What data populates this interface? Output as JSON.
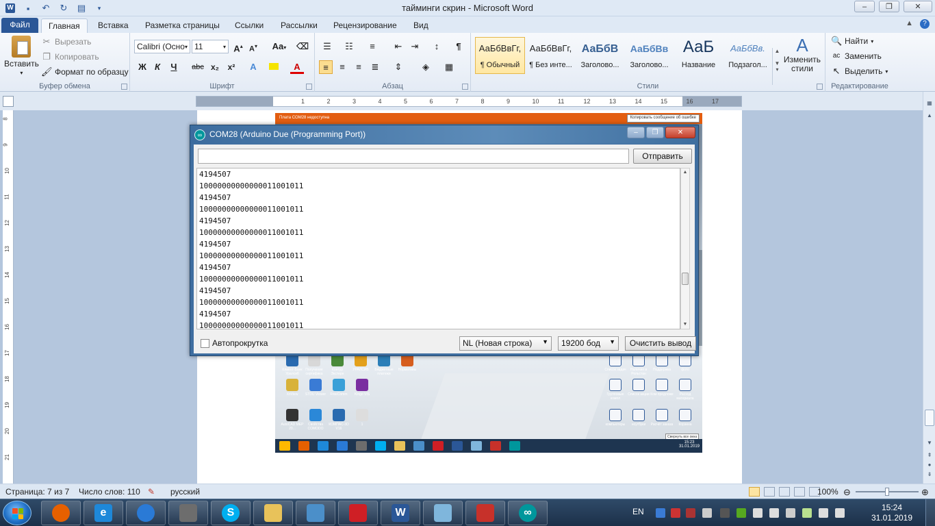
{
  "window": {
    "title": "тайминги скрин  -  Microsoft Word",
    "minimize": "–",
    "maximize": "❐",
    "close": "✕"
  },
  "tabs": {
    "file": "Файл",
    "items": [
      "Главная",
      "Вставка",
      "Разметка страницы",
      "Ссылки",
      "Рассылки",
      "Рецензирование",
      "Вид"
    ]
  },
  "ribbon": {
    "clipboard": {
      "paste": "Вставить",
      "cut": "Вырезать",
      "copy": "Копировать",
      "format_painter": "Формат по образцу",
      "label": "Буфер обмена"
    },
    "font": {
      "font_name": "Calibri (Осно",
      "font_size": "11",
      "label": "Шрифт",
      "bold": "Ж",
      "italic": "К",
      "underline": "Ч",
      "strike": "abc",
      "subscript": "x₂",
      "superscript": "x²",
      "grow": "A",
      "shrink": "A",
      "case": "Aa"
    },
    "paragraph": {
      "label": "Абзац",
      "pilcrow": "¶"
    },
    "styles": {
      "label": "Стили",
      "items": [
        {
          "sample": "АаБбВвГг,",
          "name": "¶ Обычный"
        },
        {
          "sample": "АаБбВвГг,",
          "name": "¶ Без инте..."
        },
        {
          "sample": "АаБбВ",
          "name": "Заголово..."
        },
        {
          "sample": "АаБбВв",
          "name": "Заголово..."
        },
        {
          "sample": "АаБ",
          "name": "Название"
        },
        {
          "sample": "АаБбВв.",
          "name": "Подзагол..."
        }
      ],
      "change_styles": "Изменить стили"
    },
    "editing": {
      "label": "Редактирование",
      "find": "Найти",
      "replace": "Заменить",
      "select": "Выделить"
    }
  },
  "ruler": {
    "marks": [
      "1",
      "2",
      "3",
      "4",
      "5",
      "6",
      "7",
      "8",
      "9",
      "10",
      "11",
      "12",
      "13",
      "14",
      "15",
      "16",
      "17"
    ],
    "vmarks": [
      "8",
      "9",
      "10",
      "11",
      "12",
      "13",
      "14",
      "15",
      "16",
      "17",
      "18",
      "19",
      "20",
      "21"
    ]
  },
  "embedded": {
    "bar_text": "Плата COM28 недоступна",
    "copy_btn": "Копировать сообщение об ошибке",
    "desktop_icons": [
      "Клиент-Банк Уралсиб",
      "Получение сертифика",
      "Контур Экстерн",
      "УРАЛСИБ",
      "Бюджетные платежи",
      "Нормативы",
      "XnView",
      "STDU Viewer",
      "FreeComm",
      "Klngo VIS",
      "AutoCAD MEP 20...",
      "Свойства COMODO",
      "КОМПАС-3D V16",
      "1"
    ],
    "right_icons": [
      "Список задач",
      "Наличие в Рольстан",
      "Поддержка",
      "фото",
      "Групповые компл",
      "Список акции",
      "Ком предложе",
      "Расход материала",
      "компьютеры",
      "ноутбуки",
      "Расчёт заказа",
      "Корзина"
    ],
    "time": "15:23",
    "date": "31.01.2019",
    "tooltip": "Свернуть все окна"
  },
  "serial_monitor": {
    "title": "COM28 (Arduino Due (Programming Port))",
    "input_value": "",
    "send_button": "Отправить",
    "lines": [
      "4194507",
      "10000000000000011001011",
      "4194507",
      "10000000000000011001011",
      "4194507",
      "10000000000000011001011",
      "4194507",
      "10000000000000011001011",
      "4194507",
      "10000000000000011001011",
      "4194507",
      "10000000000000011001011",
      "4194507",
      "10000000000000011001011"
    ],
    "autoscroll_label": "Автопрокрутка",
    "line_ending": "NL (Новая строка)",
    "baud": "19200 бод",
    "clear_button": "Очистить вывод"
  },
  "statusbar": {
    "page": "Страница: 7 из 7",
    "words": "Число слов: 110",
    "language": "русский",
    "zoom": "100%",
    "zoom_level": 1.0
  },
  "taskbar": {
    "lang": "EN",
    "time": "15:24",
    "date": "31.01.2019",
    "apps": [
      {
        "name": "firefox",
        "color": "#e66000"
      },
      {
        "name": "internet-explorer",
        "color": "#1e88d9"
      },
      {
        "name": "settings",
        "color": "#2a7ad6"
      },
      {
        "name": "scanner",
        "color": "#6d6d6d"
      },
      {
        "name": "skype",
        "color": "#00aff0"
      },
      {
        "name": "file-explorer",
        "color": "#e8c25a"
      },
      {
        "name": "photo-viewer",
        "color": "#4b8fc9"
      },
      {
        "name": "acrobat",
        "color": "#cf1f25"
      },
      {
        "name": "word",
        "color": "#2b5797"
      },
      {
        "name": "notes",
        "color": "#7fb6dc"
      },
      {
        "name": "toolbox",
        "color": "#c7312a"
      },
      {
        "name": "arduino",
        "color": "#00979c"
      }
    ],
    "app_glyphs": [
      "",
      "e",
      "",
      "",
      "S",
      "",
      "",
      "",
      "W",
      "",
      "",
      "∞"
    ]
  }
}
